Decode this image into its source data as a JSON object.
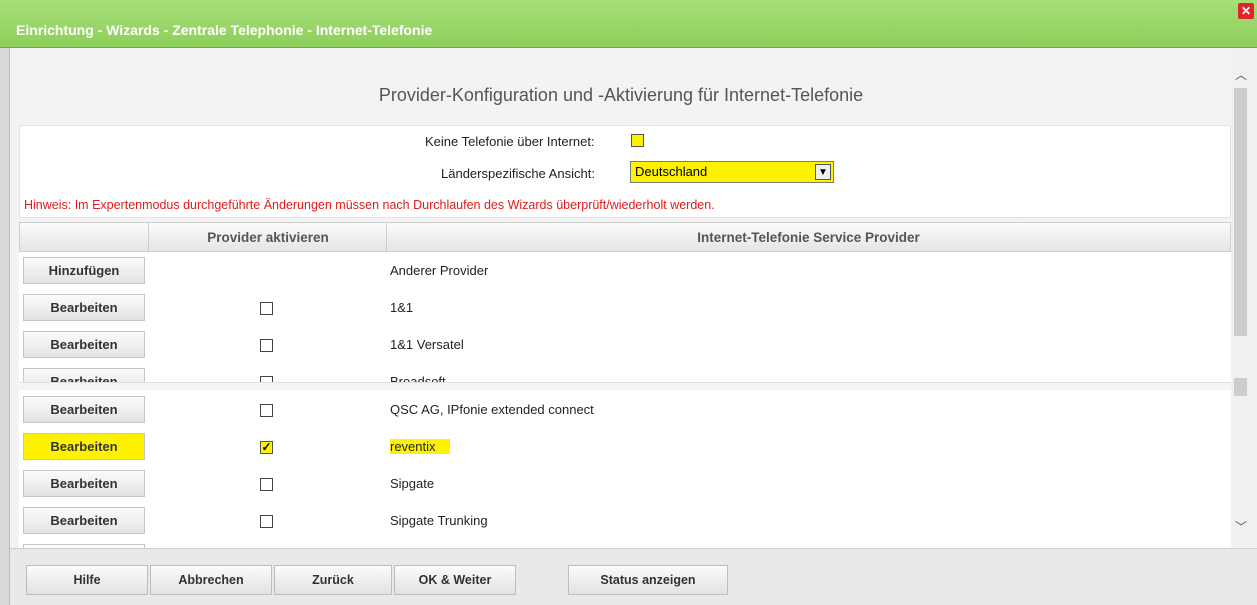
{
  "window": {
    "title": "Einrichtung - Wizards - Zentrale Telephonie - Internet-Telefonie"
  },
  "page": {
    "heading": "Provider-Konfiguration und -Aktivierung für Internet-Telefonie"
  },
  "settings": {
    "no_internet_label": "Keine Telefonie über Internet:",
    "no_internet_checked": false,
    "country_label": "Länderspezifische Ansicht:",
    "country_value": "Deutschland",
    "hint": "Hinweis: Im Expertenmodus durchgeführte Änderungen müssen nach Durchlaufen des Wizards überprüft/wiederholt werden."
  },
  "table": {
    "col_activate": "Provider aktivieren",
    "col_provider": "Internet-Telefonie Service Provider",
    "rows": [
      {
        "button": "Hinzufügen",
        "checkbox": false,
        "provider": "Anderer Provider"
      },
      {
        "button": "Bearbeiten",
        "checkbox": true,
        "checked": false,
        "provider": "1&1"
      },
      {
        "button": "Bearbeiten",
        "checkbox": true,
        "checked": false,
        "provider": "1&1 Versatel"
      },
      {
        "button": "Bearbeiten",
        "checkbox": true,
        "checked": false,
        "provider": "Broadsoft"
      },
      {
        "button": "Bearbeiten",
        "checkbox": true,
        "checked": false,
        "provider": "QSC AG, IPfonie extended connect"
      },
      {
        "button": "Bearbeiten",
        "checkbox": true,
        "checked": true,
        "provider": "reventix"
      },
      {
        "button": "Bearbeiten",
        "checkbox": true,
        "checked": false,
        "provider": "Sipgate"
      },
      {
        "button": "Bearbeiten",
        "checkbox": true,
        "checked": false,
        "provider": "Sipgate Trunking"
      }
    ]
  },
  "footer": {
    "help": "Hilfe",
    "cancel": "Abbrechen",
    "back": "Zurück",
    "ok_next": "OK & Weiter",
    "status": "Status anzeigen"
  },
  "colors": {
    "title_bar": "#8dcf5b",
    "highlight": "#fff200",
    "hint_text": "#e01b1b"
  }
}
